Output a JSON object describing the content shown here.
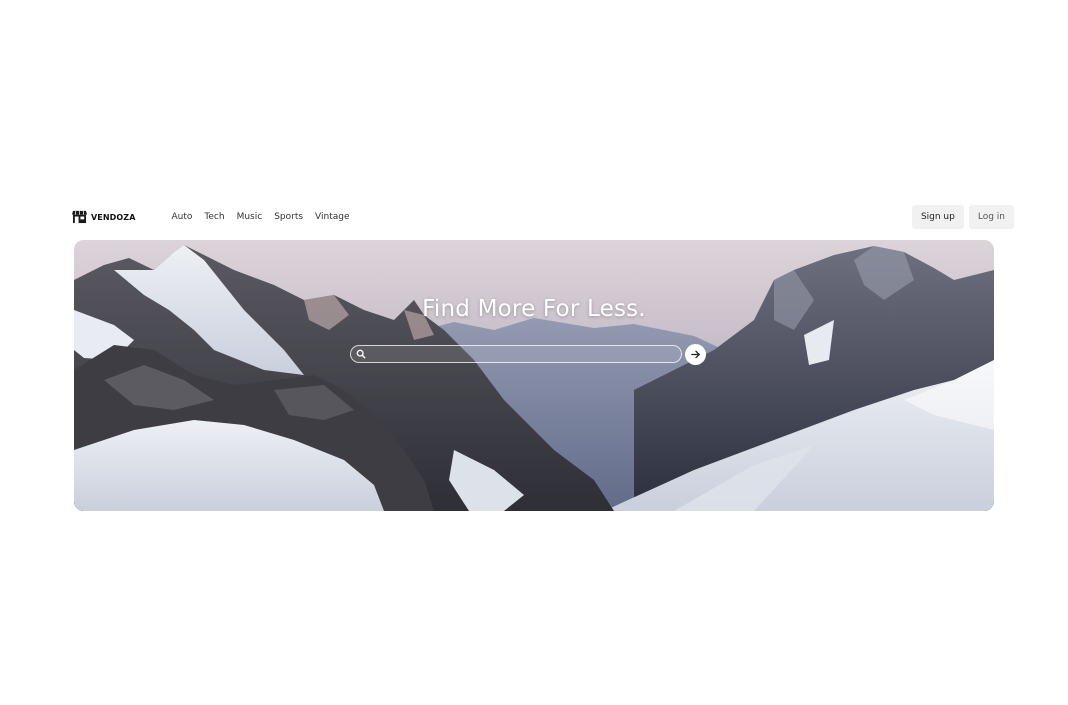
{
  "header": {
    "brand": {
      "name": "VENDOZA",
      "icon": "storefront-icon"
    },
    "nav": [
      {
        "label": "Auto"
      },
      {
        "label": "Tech"
      },
      {
        "label": "Music"
      },
      {
        "label": "Sports"
      },
      {
        "label": "Vintage"
      }
    ],
    "auth": {
      "signup_label": "Sign up",
      "login_label": "Log in"
    }
  },
  "hero": {
    "title": "Find More For Less.",
    "background": "snowy-mountain-landscape",
    "search": {
      "value": "",
      "placeholder": "",
      "icon": "search-icon",
      "submit_icon": "arrow-right-icon"
    }
  }
}
